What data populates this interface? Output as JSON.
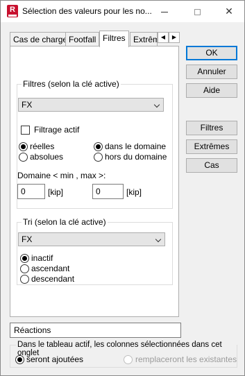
{
  "window": {
    "title": "Sélection des valeurs pour les no...",
    "minimize": "minimize",
    "maximize": "maximize",
    "close": "✕"
  },
  "tabs": [
    {
      "label": "Cas de charge"
    },
    {
      "label": "Footfall"
    },
    {
      "label": "Filtres",
      "active": true
    },
    {
      "label": "Extrêm"
    }
  ],
  "tab_scroll": {
    "left": "◀",
    "right": "▶"
  },
  "filters_group": {
    "label": "Filtres (selon la clé active)",
    "combo_value": "FX",
    "checkbox_label": "Filtrage actif",
    "checkbox_checked": false,
    "radios_left": [
      {
        "label": "réelles",
        "selected": true
      },
      {
        "label": "absolues",
        "selected": false
      }
    ],
    "radios_right": [
      {
        "label": "dans le domaine",
        "selected": true
      },
      {
        "label": "hors du domaine",
        "selected": false
      }
    ],
    "domain_label": "Domaine < min , max >:",
    "min_value": "0",
    "max_value": "0",
    "unit": "[kip]"
  },
  "sort_group": {
    "label": "Tri (selon la clé active)",
    "combo_value": "FX",
    "radios": [
      {
        "label": "inactif",
        "selected": true
      },
      {
        "label": "ascendant",
        "selected": false
      },
      {
        "label": "descendant",
        "selected": false
      }
    ]
  },
  "buttons": {
    "ok": "OK",
    "cancel": "Annuler",
    "help": "Aide",
    "filters": "Filtres",
    "extremes": "Extrêmes",
    "cases": "Cas"
  },
  "bottom": {
    "field_value": "Réactions",
    "group_label": "Dans le tableau actif, les colonnes sélectionnées dans cet onglet",
    "radio_added": {
      "label": "seront ajoutées",
      "selected": true
    },
    "radio_replace": {
      "label": "remplaceront les existantes",
      "selected": false
    }
  }
}
